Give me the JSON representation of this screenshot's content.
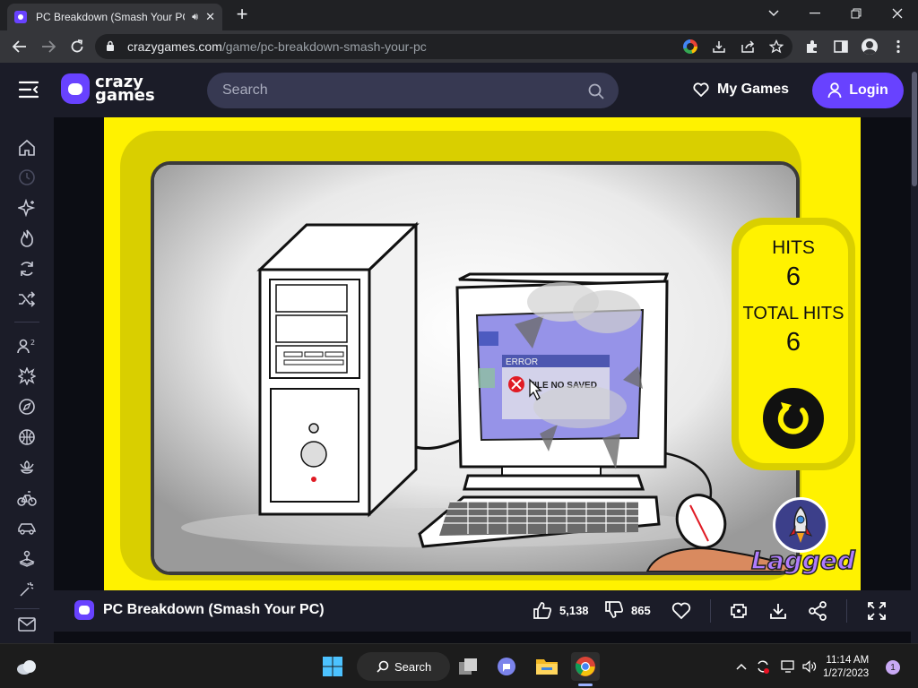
{
  "browser": {
    "tab_title": "PC Breakdown (Smash Your PC)",
    "tab_close": "✕",
    "new_tab": "+",
    "url_host": "crazygames.com",
    "url_path": "/game/pc-breakdown-smash-your-pc"
  },
  "site": {
    "logo_line1": "crazy",
    "logo_line2": "games",
    "search_placeholder": "Search",
    "my_games": "My Games",
    "login": "Login"
  },
  "game": {
    "hits_label": "HITS",
    "hits_value": "6",
    "total_hits_label": "TOTAL HITS",
    "total_hits_value": "6",
    "error_title": "ERROR",
    "error_message": "FILE NO SAVED",
    "brand": "Lagged"
  },
  "infobar": {
    "title": "PC Breakdown (Smash Your PC)",
    "likes": "5,138",
    "dislikes": "865"
  },
  "taskbar": {
    "search": "Search",
    "time": "11:14 AM",
    "date": "1/27/2023",
    "notifications": "1"
  },
  "colors": {
    "brand_purple": "#6842ff",
    "game_yellow": "#fff200",
    "header_bg": "#1b1c28"
  }
}
